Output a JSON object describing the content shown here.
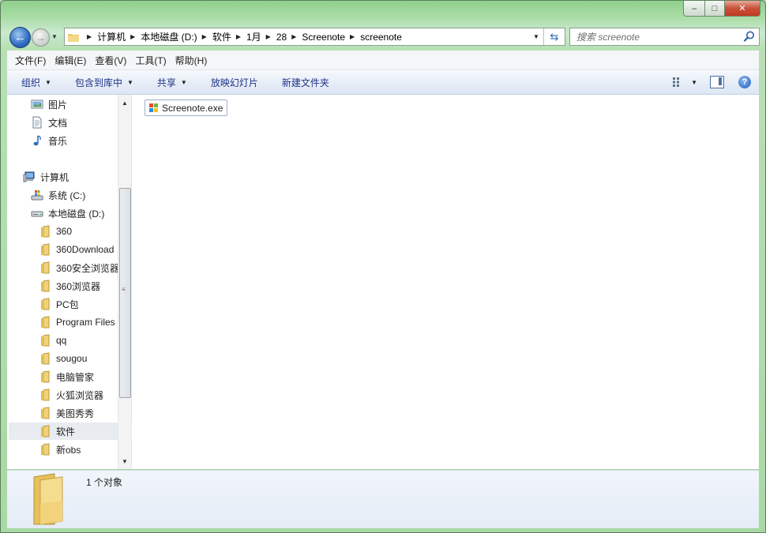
{
  "window": {
    "minimize_icon": "minimize-icon",
    "maximize_icon": "maximize-icon",
    "close_icon": "close-icon"
  },
  "address_bar": {
    "crumbs": [
      "计算机",
      "本地磁盘 (D:)",
      "软件",
      "1月",
      "28",
      "Screenote",
      "screenote"
    ]
  },
  "search": {
    "placeholder": "搜索 screenote"
  },
  "menu": [
    "文件(F)",
    "编辑(E)",
    "查看(V)",
    "工具(T)",
    "帮助(H)"
  ],
  "commands": {
    "organize": "组织",
    "include_in_library": "包含到库中",
    "share": "共享",
    "slideshow": "放映幻灯片",
    "new_folder": "新建文件夹"
  },
  "nav": {
    "libraries": [
      "图片",
      "文档",
      "音乐"
    ],
    "computer": "计算机",
    "drives": [
      "系统 (C:)",
      "本地磁盘 (D:)"
    ],
    "folders": [
      "360",
      "360Download",
      "360安全浏览器",
      "360浏览器",
      "PC包",
      "Program Files",
      "qq",
      "sougou",
      "电脑管家",
      "火狐浏览器",
      "美图秀秀",
      "软件",
      "新obs"
    ],
    "selected": "软件"
  },
  "files": [
    {
      "name": "Screenote.exe"
    }
  ],
  "details": {
    "count": "1 个对象"
  },
  "colors": {
    "accent": "#1e3287",
    "chrome": "#a8d9a4"
  }
}
